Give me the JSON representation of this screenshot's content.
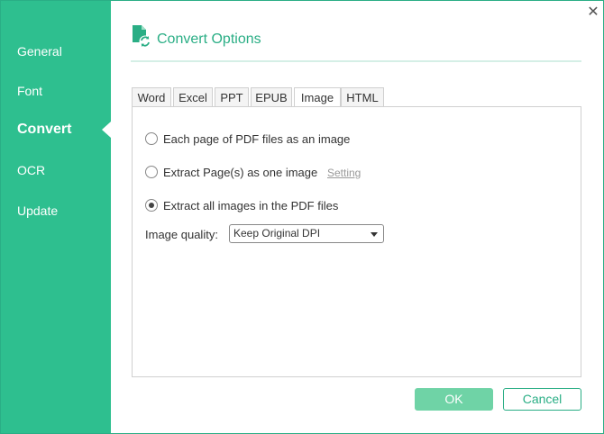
{
  "sidebar": {
    "items": [
      {
        "label": "General"
      },
      {
        "label": "Font"
      },
      {
        "label": "Convert"
      },
      {
        "label": "OCR"
      },
      {
        "label": "Update"
      }
    ],
    "active_index": 2
  },
  "header": {
    "title": "Convert Options",
    "icon": "pdf-convert-icon"
  },
  "tabs": [
    {
      "label": "Word"
    },
    {
      "label": "Excel"
    },
    {
      "label": "PPT"
    },
    {
      "label": "EPUB"
    },
    {
      "label": "Image"
    },
    {
      "label": "HTML"
    }
  ],
  "active_tab": "Image",
  "options": [
    {
      "label": "Each page of PDF files as an image",
      "checked": false
    },
    {
      "label": "Extract Page(s) as one image",
      "checked": false
    },
    {
      "label": "Extract all images in the PDF files",
      "checked": true
    }
  ],
  "setting_link": "Setting",
  "quality": {
    "label": "Image quality:",
    "value": "Keep Original DPI"
  },
  "buttons": {
    "ok": "OK",
    "cancel": "Cancel"
  },
  "colors": {
    "accent": "#2ebf8f",
    "ok_button": "#6fd3a6"
  }
}
